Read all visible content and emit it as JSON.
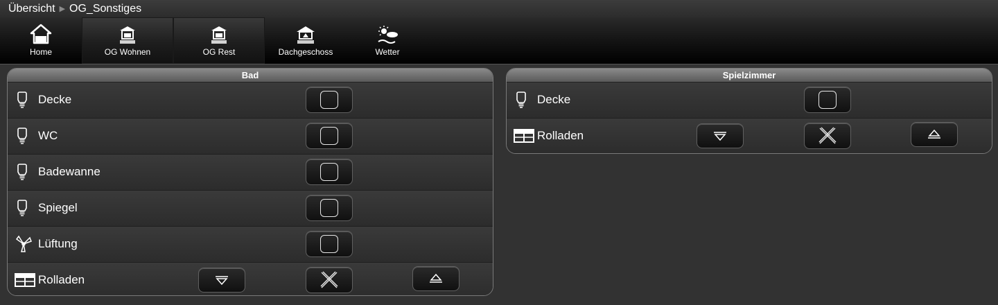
{
  "breadcrumb": {
    "root": "Übersicht",
    "current": "OG_Sonstiges"
  },
  "nav": [
    {
      "label": "Home",
      "icon": "home-icon"
    },
    {
      "label": "OG Wohnen",
      "icon": "house-og-icon"
    },
    {
      "label": "OG Rest",
      "icon": "house-og-icon"
    },
    {
      "label": "Dachgeschoss",
      "icon": "house-roof-icon"
    },
    {
      "label": "Wetter",
      "icon": "weather-icon"
    }
  ],
  "bad": {
    "title": "Bad",
    "rows": [
      {
        "label": "Decke",
        "icon": "bulb-icon",
        "state": "off"
      },
      {
        "label": "WC",
        "icon": "bulb-icon",
        "state": "off"
      },
      {
        "label": "Badewanne",
        "icon": "bulb-icon",
        "state": "off"
      },
      {
        "label": "Spiegel",
        "icon": "bulb-icon",
        "state": "off"
      },
      {
        "label": "Lüftung",
        "icon": "fan-icon",
        "state": "off"
      },
      {
        "label": "Rolladen",
        "icon": "window-icon"
      }
    ]
  },
  "spielzimmer": {
    "title": "Spielzimmer",
    "rows": [
      {
        "label": "Decke",
        "icon": "bulb-icon",
        "state": "off"
      },
      {
        "label": "Rolladen",
        "icon": "window-icon"
      }
    ]
  },
  "colors": {
    "background": "#323232",
    "header": "#6f6f6f",
    "text": "#ffffff"
  }
}
